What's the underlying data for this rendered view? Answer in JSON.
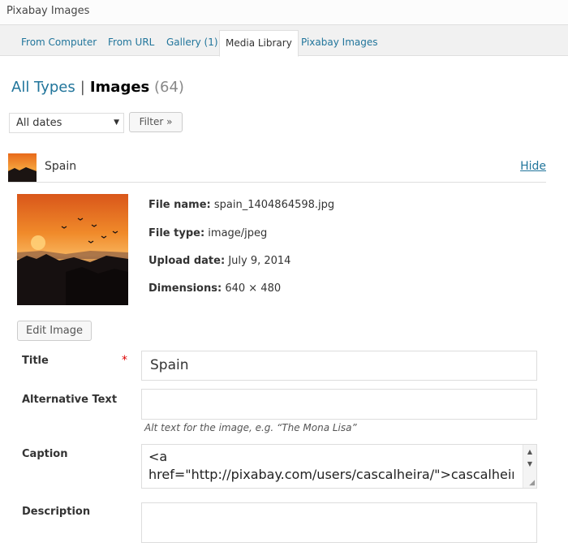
{
  "header": {
    "title": "Pixabay Images"
  },
  "tabs": [
    {
      "label": "From Computer"
    },
    {
      "label": "From URL"
    },
    {
      "label": "Gallery (1)"
    },
    {
      "label": "Media Library"
    },
    {
      "label": "Pixabay Images"
    }
  ],
  "active_tab": "Media Library",
  "type_filter": {
    "all": "All Types",
    "separator": "|",
    "current": "Images",
    "count": "(64)"
  },
  "filter": {
    "dates_selected": "All dates",
    "button": "Filter »"
  },
  "item": {
    "name": "Spain",
    "toggle_link": "Hide",
    "file_name_label": "File name:",
    "file_name": "spain_1404864598.jpg",
    "file_type_label": "File type:",
    "file_type": "image/jpeg",
    "upload_date_label": "Upload date:",
    "upload_date": "July 9, 2014",
    "dimensions_label": "Dimensions:",
    "dimensions": "640 × 480",
    "edit_button": "Edit Image"
  },
  "form": {
    "title_label": "Title",
    "title_required_mark": "*",
    "title_value": "Spain",
    "alt_label": "Alternative Text",
    "alt_value": "",
    "alt_help": "Alt text for the image, e.g. “The Mona Lisa”",
    "caption_label": "Caption",
    "caption_value": "<a\nhref=\"http://pixabay.com/users/cascalheira/\">cascalheira</a>",
    "description_label": "Description",
    "description_value": ""
  },
  "icons": {
    "dropdown": "caret-down-icon",
    "scroll_up": "scroll-up-icon",
    "scroll_down": "scroll-down-icon",
    "resize": "resize-grip-icon"
  },
  "colors": {
    "link": "#21759b",
    "required": "#dd0000",
    "border": "#dddddd"
  }
}
